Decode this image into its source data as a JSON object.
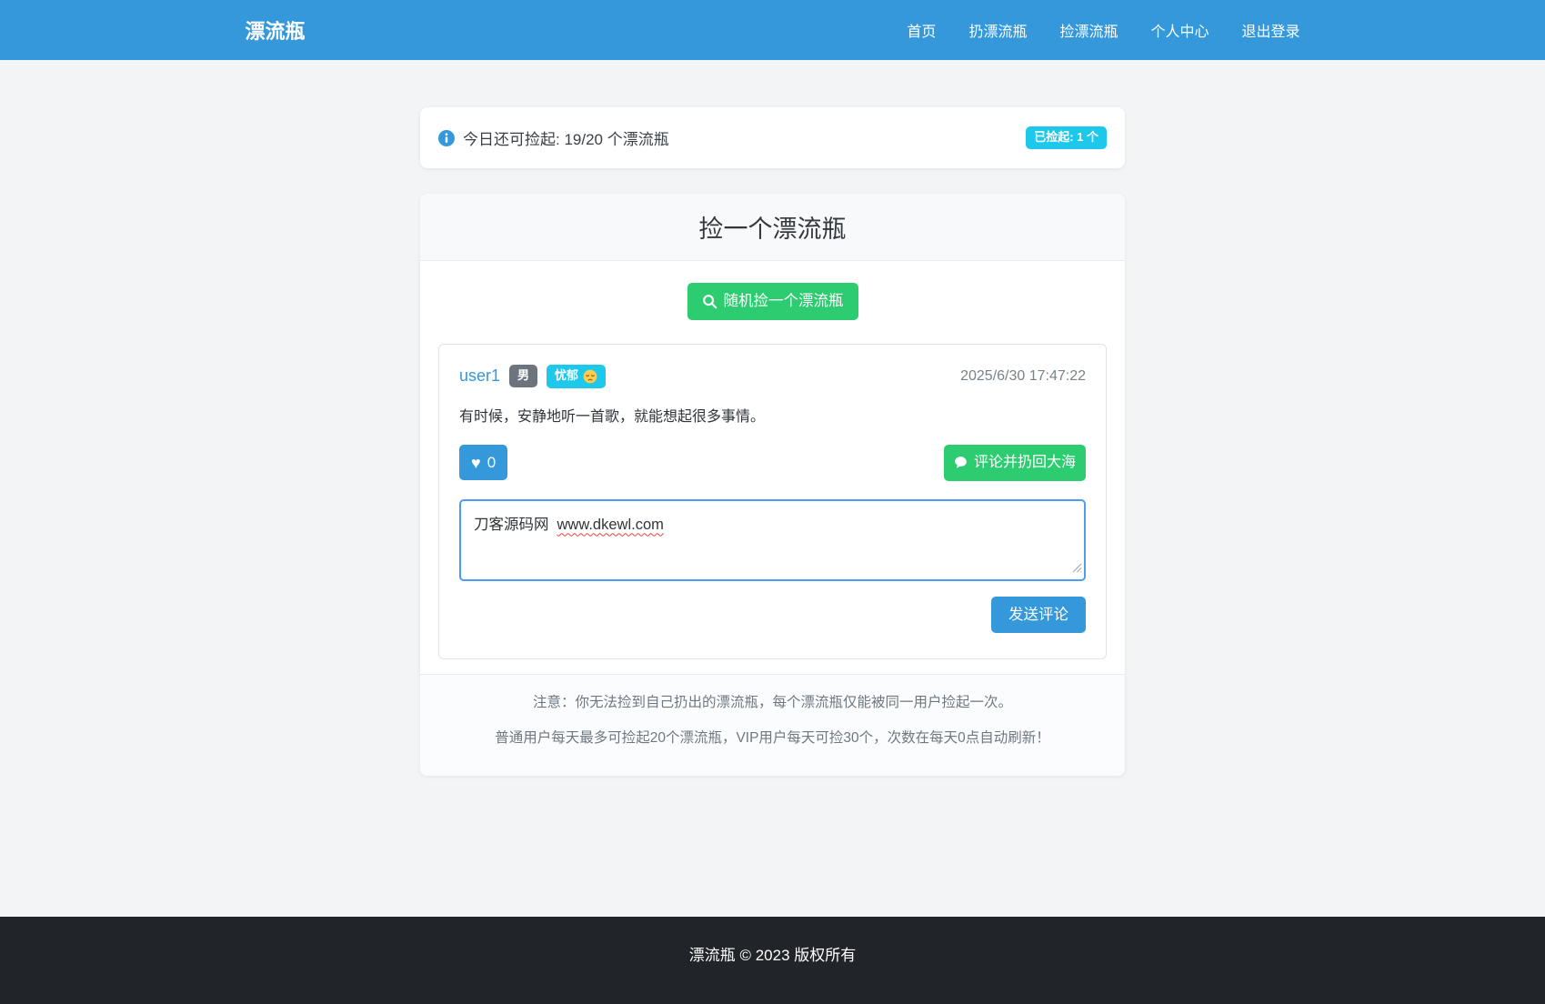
{
  "navbar": {
    "brand": "漂流瓶",
    "links": [
      {
        "label": "首页"
      },
      {
        "label": "扔漂流瓶"
      },
      {
        "label": "捡漂流瓶"
      },
      {
        "label": "个人中心"
      },
      {
        "label": "退出登录"
      }
    ]
  },
  "quota_bar": {
    "text": "今日还可捡起: 19/20 个漂流瓶",
    "badge": "已捡起: 1 个"
  },
  "pick_card": {
    "title": "捡一个漂流瓶",
    "random_button": "随机捡一个漂流瓶",
    "bottle": {
      "username": "user1",
      "gender": "男",
      "mood": "忧郁",
      "time": "2025/6/30 17:47:22",
      "message": "有时候，安静地听一首歌，就能想起很多事情。",
      "likes": "0",
      "comment_button": "评论并扔回大海",
      "comment": {
        "prefix": "刀客源码网",
        "url": "www.dkewl.com"
      },
      "send_button": "发送评论"
    },
    "notes": [
      "注意：你无法捡到自己扔出的漂流瓶，每个漂流瓶仅能被同一用户捡起一次。",
      "普通用户每天最多可捡起20个漂流瓶，VIP用户每天可捡30个，次数在每天0点自动刷新！"
    ]
  },
  "footer": {
    "copyright": "漂流瓶 © 2023 版权所有"
  },
  "icons": {
    "heart": "♥"
  },
  "colors": {
    "navbar_bg": "#3498db",
    "primary": "#3498db",
    "success": "#2ecc71",
    "info_badge": "#1ec8eb",
    "secondary_badge": "#6c757d",
    "comment_focus_border": "#4a9cf4",
    "spellcheck_underline": "#e8443a",
    "page_bg": "#f3f4f5",
    "footer_bg": "#212428"
  }
}
